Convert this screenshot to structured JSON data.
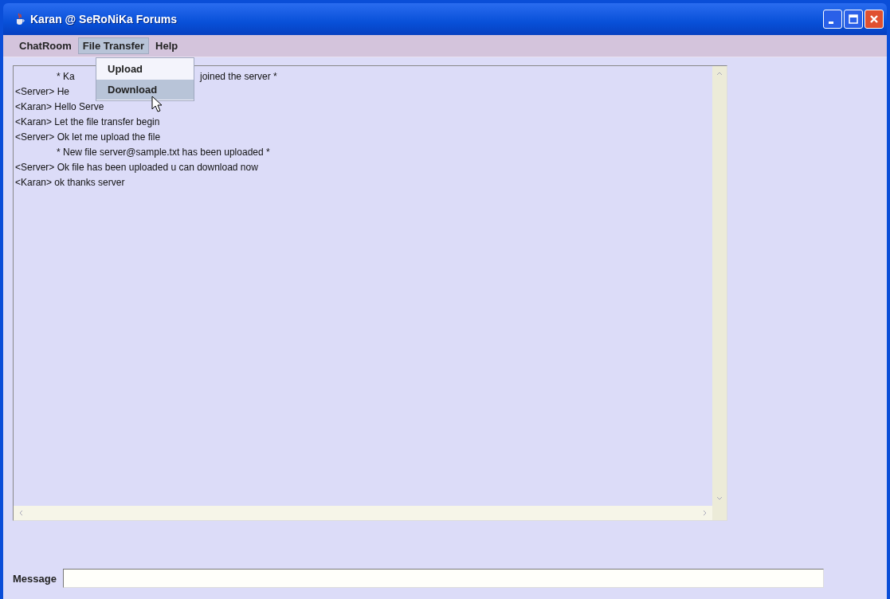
{
  "window": {
    "title": "Karan @ SeRoNiKa Forums"
  },
  "menu_bar": [
    {
      "label": "ChatRoom",
      "selected": false
    },
    {
      "label": "File Transfer",
      "selected": true
    },
    {
      "label": "Help",
      "selected": false
    }
  ],
  "open_menu": {
    "items": [
      {
        "label": "Upload",
        "selected": false
      },
      {
        "label": "Download",
        "selected": true
      }
    ]
  },
  "chat_log": [
    {
      "kind": "system",
      "text": "* Ka",
      "text_after_menu": "joined the server *"
    },
    {
      "kind": "message",
      "text": "<Server> He"
    },
    {
      "kind": "message",
      "text": "<Karan> Hello Serve"
    },
    {
      "kind": "message",
      "text": "<Karan> Let the file transfer begin"
    },
    {
      "kind": "message",
      "text": "<Server> Ok let me upload the file"
    },
    {
      "kind": "system",
      "text": "* New file server@sample.txt has been uploaded *"
    },
    {
      "kind": "message",
      "text": "<Server> Ok file has been uploaded u can download now"
    },
    {
      "kind": "message",
      "text": "<Karan> ok thanks server"
    }
  ],
  "message": {
    "label": "Message"
  }
}
